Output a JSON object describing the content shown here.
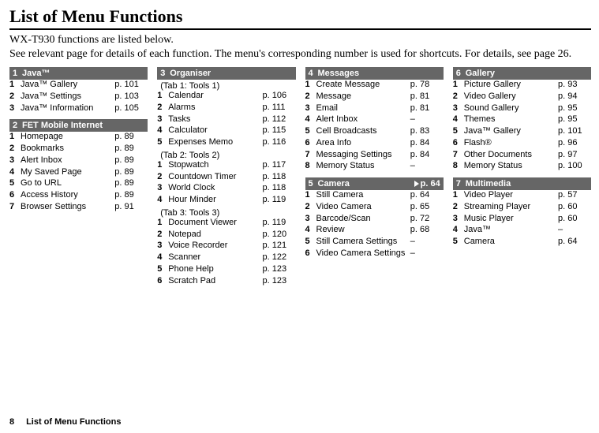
{
  "title": "List of Menu Functions",
  "intro": "WX-T930 functions are listed below.",
  "intro2": "See relevant page for details of each function. The menu's corresponding number is used for shortcuts. For details, see page 26.",
  "footer": {
    "page": "8",
    "label": "List of Menu Functions"
  },
  "sections": [
    {
      "num": "1",
      "title": "Java™",
      "items": [
        {
          "n": "1",
          "t": "Java™ Gallery",
          "p": "p. 101"
        },
        {
          "n": "2",
          "t": "Java™ Settings",
          "p": "p. 103"
        },
        {
          "n": "3",
          "t": "Java™ Information",
          "p": "p. 105"
        }
      ]
    },
    {
      "num": "2",
      "title": "FET Mobile Internet",
      "items": [
        {
          "n": "1",
          "t": "Homepage",
          "p": "p. 89"
        },
        {
          "n": "2",
          "t": "Bookmarks",
          "p": "p. 89"
        },
        {
          "n": "3",
          "t": "Alert Inbox",
          "p": "p. 89"
        },
        {
          "n": "4",
          "t": "My Saved Page",
          "p": "p. 89"
        },
        {
          "n": "5",
          "t": "Go to URL",
          "p": "p. 89"
        },
        {
          "n": "6",
          "t": "Access History",
          "p": "p. 89"
        },
        {
          "n": "7",
          "t": "Browser Settings",
          "p": "p. 91"
        }
      ]
    },
    {
      "num": "3",
      "title": "Organiser",
      "sub1": "(Tab 1: Tools 1)",
      "items1": [
        {
          "n": "1",
          "t": "Calendar",
          "p": "p. 106"
        },
        {
          "n": "2",
          "t": "Alarms",
          "p": "p. 111"
        },
        {
          "n": "3",
          "t": "Tasks",
          "p": "p. 112"
        },
        {
          "n": "4",
          "t": "Calculator",
          "p": "p. 115"
        },
        {
          "n": "5",
          "t": "Expenses Memo",
          "p": "p. 116"
        }
      ],
      "sub2": "(Tab 2: Tools 2)",
      "items2": [
        {
          "n": "1",
          "t": "Stopwatch",
          "p": "p. 117"
        },
        {
          "n": "2",
          "t": "Countdown Timer",
          "p": "p. 118"
        },
        {
          "n": "3",
          "t": "World Clock",
          "p": "p. 118"
        },
        {
          "n": "4",
          "t": "Hour Minder",
          "p": "p. 119"
        }
      ],
      "sub3": "(Tab 3: Tools 3)",
      "items3": [
        {
          "n": "1",
          "t": "Document Viewer",
          "p": "p. 119"
        },
        {
          "n": "2",
          "t": "Notepad",
          "p": "p. 120"
        },
        {
          "n": "3",
          "t": "Voice Recorder",
          "p": "p. 121"
        },
        {
          "n": "4",
          "t": "Scanner",
          "p": "p. 122"
        },
        {
          "n": "5",
          "t": "Phone Help",
          "p": "p. 123"
        },
        {
          "n": "6",
          "t": "Scratch Pad",
          "p": "p. 123"
        }
      ]
    },
    {
      "num": "4",
      "title": "Messages",
      "items": [
        {
          "n": "1",
          "t": "Create Message",
          "p": "p. 78"
        },
        {
          "n": "2",
          "t": "Message",
          "p": "p. 81"
        },
        {
          "n": "3",
          "t": "Email",
          "p": "p. 81"
        },
        {
          "n": "4",
          "t": "Alert Inbox",
          "p": "–"
        },
        {
          "n": "5",
          "t": "Cell Broadcasts",
          "p": "p. 83"
        },
        {
          "n": "6",
          "t": "Area Info",
          "p": "p. 84"
        },
        {
          "n": "7",
          "t": "Messaging Settings",
          "p": "p. 84"
        },
        {
          "n": "8",
          "t": "Memory Status",
          "p": "–"
        }
      ]
    },
    {
      "num": "5",
      "title": "Camera",
      "headerPage": "p. 64",
      "items": [
        {
          "n": "1",
          "t": "Still Camera",
          "p": "p. 64"
        },
        {
          "n": "2",
          "t": "Video Camera",
          "p": "p. 65"
        },
        {
          "n": "3",
          "t": "Barcode/Scan",
          "p": "p. 72"
        },
        {
          "n": "4",
          "t": "Review",
          "p": "p. 68"
        },
        {
          "n": "5",
          "t": "Still Camera Settings",
          "p": "–"
        },
        {
          "n": "6",
          "t": "Video Camera Settings",
          "p": "–"
        }
      ]
    },
    {
      "num": "6",
      "title": "Gallery",
      "items": [
        {
          "n": "1",
          "t": "Picture Gallery",
          "p": "p. 93"
        },
        {
          "n": "2",
          "t": "Video Gallery",
          "p": "p. 94"
        },
        {
          "n": "3",
          "t": "Sound Gallery",
          "p": "p. 95"
        },
        {
          "n": "4",
          "t": "Themes",
          "p": "p. 95"
        },
        {
          "n": "5",
          "t": "Java™ Gallery",
          "p": "p. 101"
        },
        {
          "n": "6",
          "t": "Flash®",
          "p": "p. 96"
        },
        {
          "n": "7",
          "t": "Other Documents",
          "p": "p. 97"
        },
        {
          "n": "8",
          "t": "Memory Status",
          "p": "p. 100"
        }
      ]
    },
    {
      "num": "7",
      "title": "Multimedia",
      "items": [
        {
          "n": "1",
          "t": "Video Player",
          "p": "p. 57"
        },
        {
          "n": "2",
          "t": "Streaming Player",
          "p": "p. 60"
        },
        {
          "n": "3",
          "t": "Music Player",
          "p": "p. 60"
        },
        {
          "n": "4",
          "t": "Java™",
          "p": "–"
        },
        {
          "n": "5",
          "t": "Camera",
          "p": "p. 64"
        }
      ]
    }
  ]
}
